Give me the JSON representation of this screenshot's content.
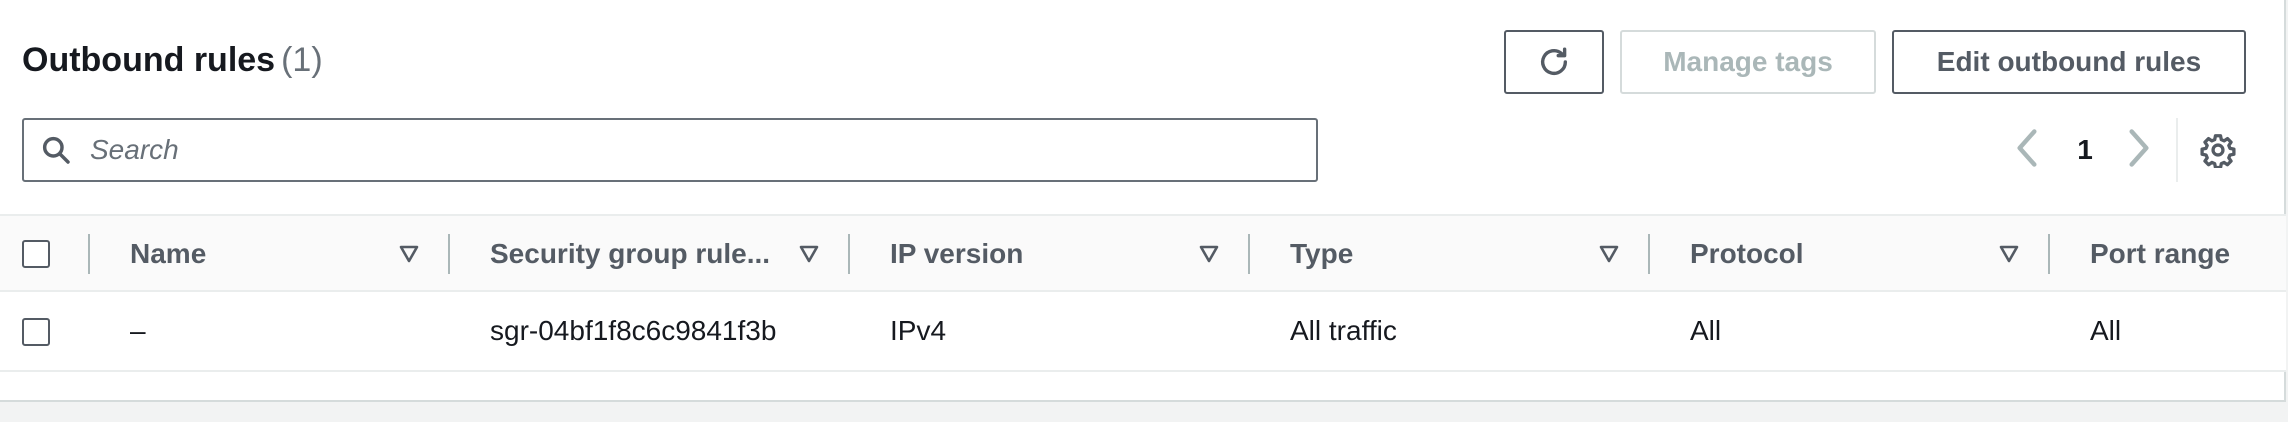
{
  "header": {
    "title": "Outbound rules",
    "count": "(1)"
  },
  "buttons": {
    "refresh_icon": "refresh-icon",
    "manage_tags": "Manage tags",
    "edit_outbound_rules": "Edit outbound rules"
  },
  "search": {
    "placeholder": "Search",
    "value": ""
  },
  "pagination": {
    "current_page": "1",
    "prev_icon": "chevron-left-icon",
    "next_icon": "chevron-right-icon",
    "settings_icon": "gear-icon"
  },
  "table": {
    "columns": [
      "Name",
      "Security group rule...",
      "IP version",
      "Type",
      "Protocol",
      "Port range"
    ],
    "rows": [
      {
        "name": "–",
        "security_group_rule_id": "sgr-04bf1f8c6c9841f3b",
        "ip_version": "IPv4",
        "type": "All traffic",
        "protocol": "All",
        "port_range": "All"
      }
    ]
  },
  "colors": {
    "border": "#545b64",
    "disabled": "#aab7b8",
    "header_bg": "#fafafa",
    "text": "#16191f"
  }
}
